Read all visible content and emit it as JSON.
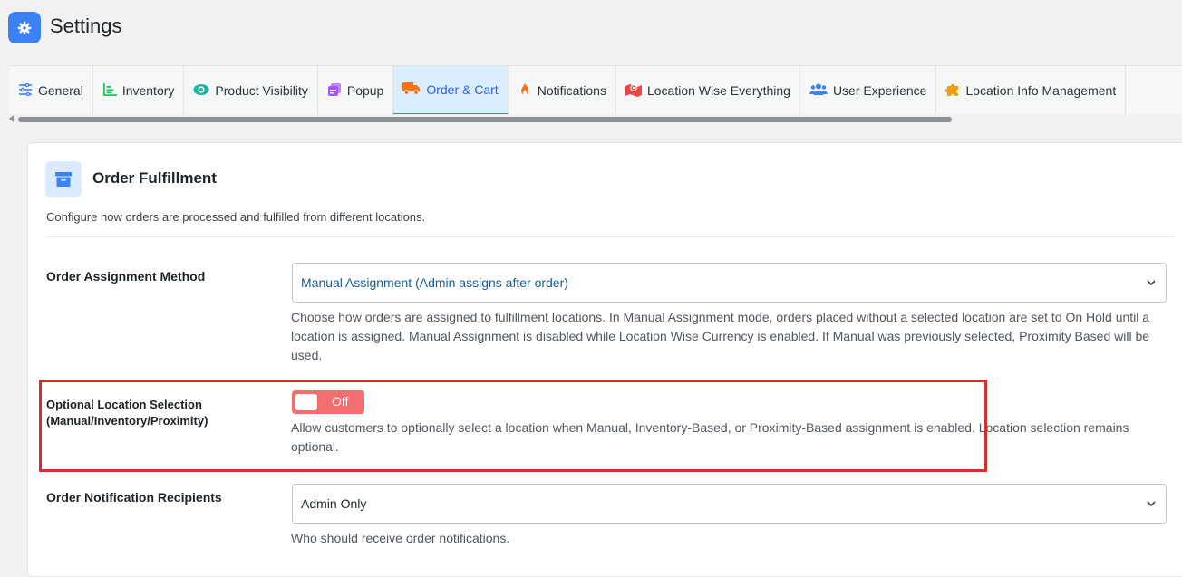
{
  "header": {
    "title": "Settings",
    "icon": "gear-icon"
  },
  "tabs": [
    {
      "label": "General",
      "icon": "sliders-icon",
      "color": "#3b82f6",
      "active": false
    },
    {
      "label": "Inventory",
      "icon": "bar-chart-icon",
      "color": "#22c55e",
      "active": false
    },
    {
      "label": "Product Visibility",
      "icon": "eye-icon",
      "color": "#14b8a6",
      "active": false
    },
    {
      "label": "Popup",
      "icon": "popup-icon",
      "color": "#a855f7",
      "active": false
    },
    {
      "label": "Order & Cart",
      "icon": "truck-icon",
      "color": "#f97316",
      "active": true
    },
    {
      "label": "Notifications",
      "icon": "flame-icon",
      "color": "#f97316",
      "active": false
    },
    {
      "label": "Location Wise Everything",
      "icon": "map-icon",
      "color": "#ef4444",
      "active": false
    },
    {
      "label": "User Experience",
      "icon": "users-icon",
      "color": "#3b82f6",
      "active": false
    },
    {
      "label": "Location Info Management",
      "icon": "puzzle-icon",
      "color": "#f59e0b",
      "active": false
    }
  ],
  "section": {
    "title": "Order Fulfillment",
    "icon": "archive-box-icon",
    "description": "Configure how orders are processed and fulfilled from different locations."
  },
  "fields": {
    "assignment": {
      "label": "Order Assignment Method",
      "value": "Manual Assignment (Admin assigns after order)",
      "help": "Choose how orders are assigned to fulfillment locations. In Manual Assignment mode, orders placed without a selected location are set to On Hold until a location is assigned. Manual Assignment is disabled while Location Wise Currency is enabled. If Manual was previously selected, Proximity Based will be used."
    },
    "optional_location": {
      "label": "Optional Location Selection (Manual/Inventory/Proximity)",
      "toggle_state": "Off",
      "enabled": false,
      "help": "Allow customers to optionally select a location when Manual, Inventory-Based, or Proximity-Based assignment is enabled. Location selection remains optional."
    },
    "recipients": {
      "label": "Order Notification Recipients",
      "value": "Admin Only",
      "help": "Who should receive order notifications."
    }
  },
  "colors": {
    "accent": "#3b82f6",
    "toggle_off": "#f26d6d",
    "highlight": "#d32f2f"
  }
}
